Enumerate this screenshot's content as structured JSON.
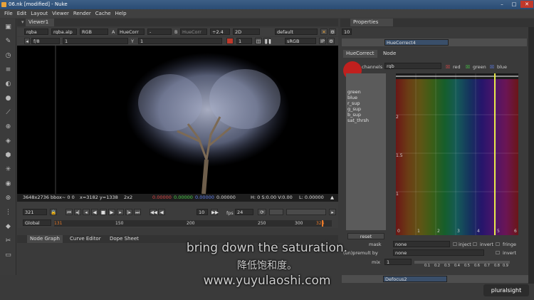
{
  "window": {
    "title": "06.nk [modified] - Nuke",
    "minimize": "–",
    "maximize": "□",
    "close": "✕"
  },
  "menu": [
    "File",
    "Edit",
    "Layout",
    "Viewer",
    "Render",
    "Cache",
    "Help"
  ],
  "viewer": {
    "tab": "Viewer1",
    "channels": "rgba",
    "alpha": "rgba.alp",
    "display": "RGB",
    "a_label": "A",
    "a_input": "HueCorr",
    "dash": "-",
    "b_label": "B",
    "b_input": "HueCorr",
    "gain": "÷2.4",
    "mode2d": "2D",
    "lut": "default",
    "fstop": "f/8",
    "frame_field": "1",
    "y_label": "Y",
    "y_value": "1",
    "one": "1",
    "srgb": "sRGB",
    "info": {
      "format": "3648x2736 bbox~ 0 0",
      "coords": "x=3182 y=1338",
      "zoom": "2x2",
      "r": "0.00000",
      "g": "0.00000",
      "b": "0.00000",
      "a": "0.00000",
      "hsv": "H: 0 S:0.00 V:0.00",
      "l": "L: 0.00000"
    },
    "playback": {
      "frame": "321",
      "step": "10",
      "fps_label": "fps",
      "fps": "24",
      "range": "Global",
      "ticks": [
        "131",
        "150",
        "200",
        "250",
        "300",
        "324"
      ],
      "timeline_current": 0.97
    }
  },
  "nodegraph": {
    "tabs": [
      "Node Graph",
      "Curve Editor",
      "Dope Sheet"
    ]
  },
  "properties": {
    "title": "Properties",
    "count": "10",
    "node_name": "HueCorrect4",
    "tabs": [
      "HueCorrect",
      "Node"
    ],
    "channels_label": "channels",
    "channels": "rgb",
    "ch_red": "red",
    "ch_green": "green",
    "ch_blue": "blue",
    "curves": [
      "green",
      "blue",
      "r_sup",
      "g_sup",
      "b_sup",
      "sat_thrsh"
    ],
    "y_ticks": [
      "2",
      "1.5",
      "1",
      "0.5"
    ],
    "x_ticks": [
      "0",
      "1",
      "2",
      "3",
      "4",
      "5",
      "6"
    ],
    "reset": "reset",
    "mask_label": "mask",
    "mask_value": "none",
    "inject": "inject",
    "invert": "invert",
    "fringe": "fringe",
    "premult_label": "(un)premult by",
    "premult_value": "none",
    "invert2": "invert",
    "mix_label": "mix",
    "mix_value": "1",
    "mix_ticks": [
      "0.1",
      "0.2",
      "0.3",
      "0.4",
      "0.5",
      "0.6",
      "0.7",
      "0.8",
      "0.9"
    ],
    "next_node": "Defocus2"
  },
  "subtitle": {
    "en": "bring down the saturation.",
    "zh": "降低饱和度。",
    "url": "www.yuyulaoshi.com"
  },
  "logo": "pluralsight",
  "colors": {
    "accent": "#e9a33a",
    "cursor_red": "#c0201e",
    "playhead": "#e8e84a"
  }
}
